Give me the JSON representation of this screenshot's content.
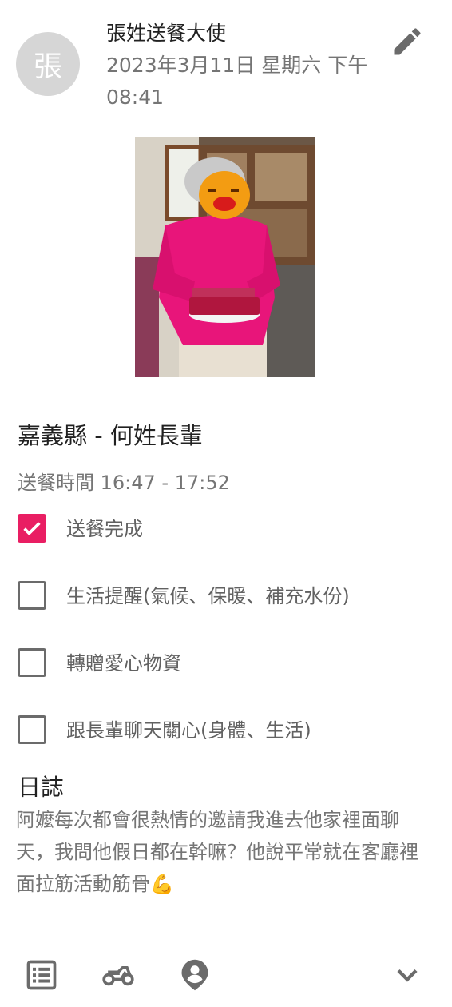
{
  "header": {
    "avatar_char": "張",
    "author": "張姓送餐大使",
    "datetime": "2023年3月11日 星期六 下午08:41"
  },
  "icons": {
    "edit": "pencil-icon",
    "bottom": [
      "list-icon",
      "motorcycle-icon",
      "location-person-icon",
      "chevron-down-icon"
    ]
  },
  "recipient": "嘉義縣 - 何姓長輩",
  "delivery_time": "送餐時間 16:47 - 17:52",
  "checklist": [
    {
      "label": "送餐完成",
      "checked": true
    },
    {
      "label": "生活提醒(氣候、保暖、補充水份)",
      "checked": false
    },
    {
      "label": "轉贈愛心物資",
      "checked": false
    },
    {
      "label": "跟長輩聊天關心(身體、生活)",
      "checked": false
    }
  ],
  "journal": {
    "title": "日誌",
    "body": "阿嬤每次都會很熱情的邀請我進去他家裡面聊天，我問他假日都在幹嘛？他說平常就在客廳裡面拉筋活動筋骨💪"
  },
  "colors": {
    "accent": "#e91e63",
    "icon": "#6b6b6b",
    "secondary_text": "#757575"
  }
}
